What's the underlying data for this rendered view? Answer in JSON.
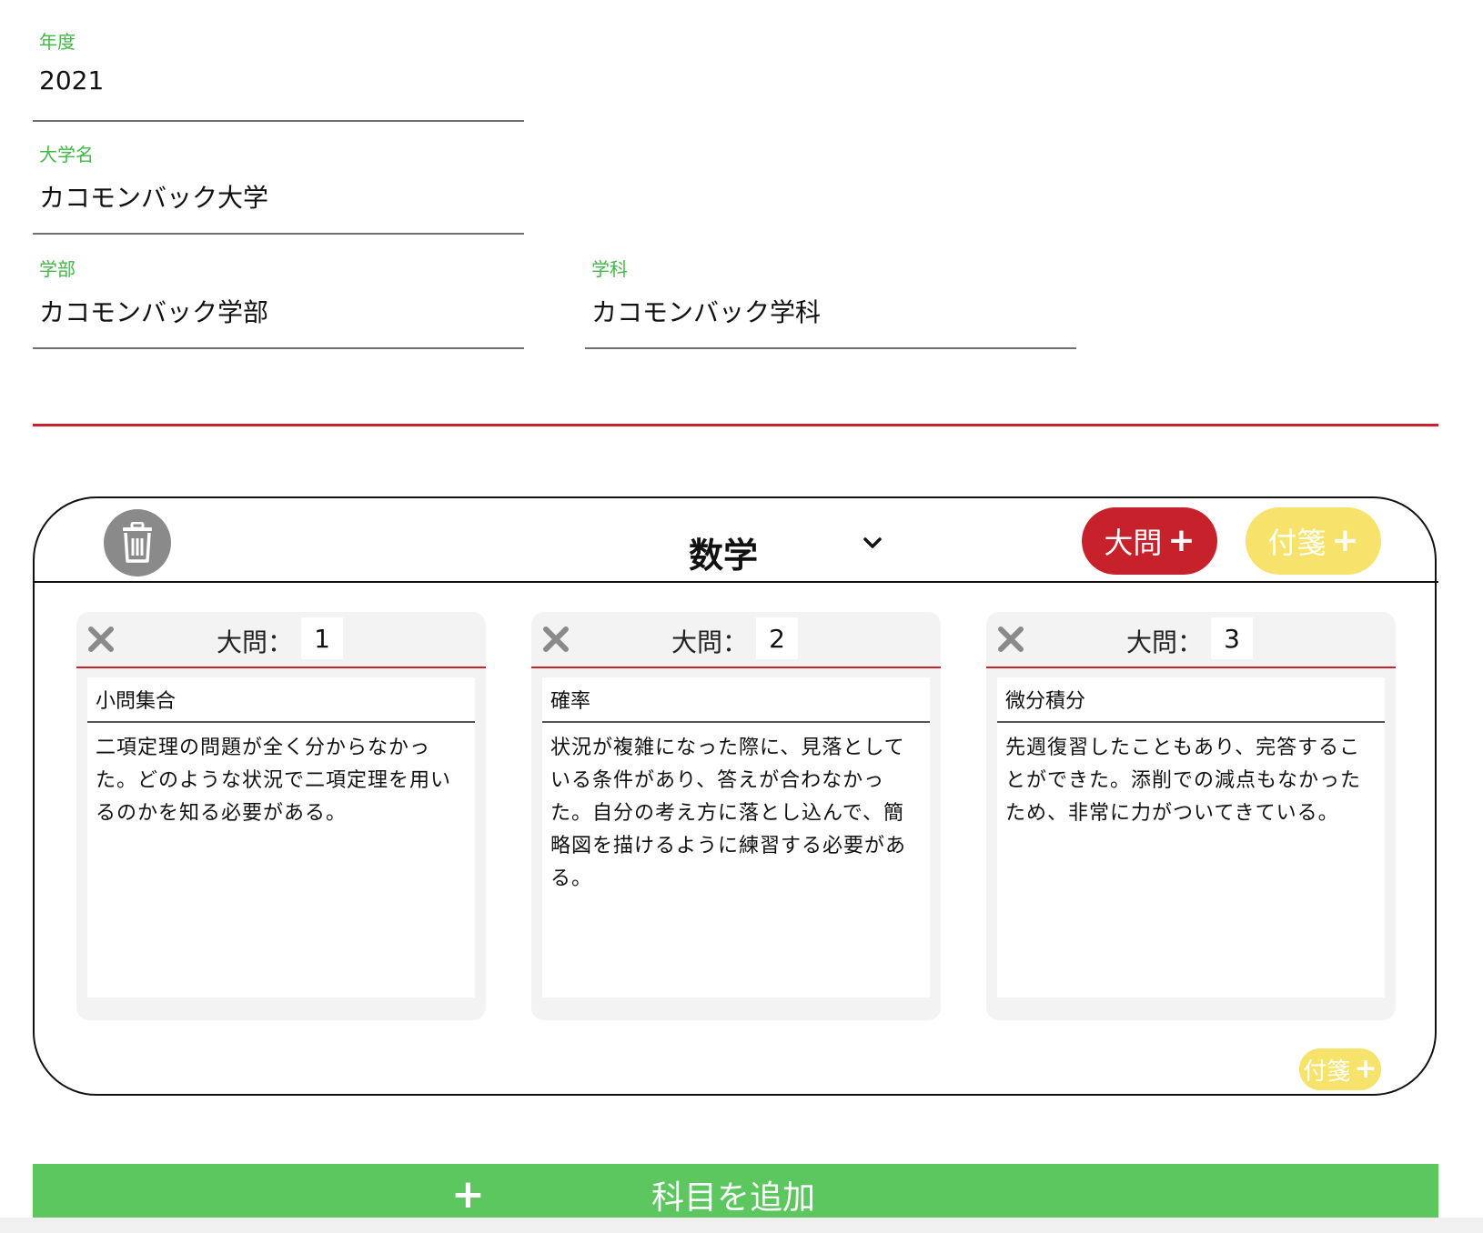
{
  "form": {
    "year": {
      "label": "年度",
      "value": "2021"
    },
    "university": {
      "label": "大学名",
      "value": "カコモンバック大学"
    },
    "faculty": {
      "label": "学部",
      "value": "カコモンバック学部"
    },
    "department": {
      "label": "学科",
      "value": "カコモンバック学科"
    }
  },
  "subject": {
    "name": "数学",
    "add_question_label": "大問",
    "add_note_label": "付箋",
    "note_small_label": "付箋",
    "questions": [
      {
        "label": "大問：",
        "number": "1",
        "title": "小問集合",
        "body": "二項定理の問題が全く分からなかった。どのような状況で二項定理を用いるのかを知る必要がある。"
      },
      {
        "label": "大問：",
        "number": "2",
        "title": "確率",
        "body": "状況が複雑になった際に、見落としている条件があり、答えが合わなかった。自分の考え方に落とし込んで、簡略図を描けるように練習する必要がある。"
      },
      {
        "label": "大問：",
        "number": "3",
        "title": "微分積分",
        "body": "先週復習したこともあり、完答することができた。添削での減点もなかったため、非常に力がついてきている。"
      }
    ]
  },
  "add_subject_label": "科目を追加",
  "icons": {
    "trash": "trash-icon",
    "chevron": "chevron-down-icon",
    "close": "close-icon",
    "plus": "plus-icon"
  },
  "colors": {
    "label_green": "#45b649",
    "accent_red": "#c7212b",
    "note_yellow": "#f7e26b",
    "add_green": "#5cc65f"
  }
}
